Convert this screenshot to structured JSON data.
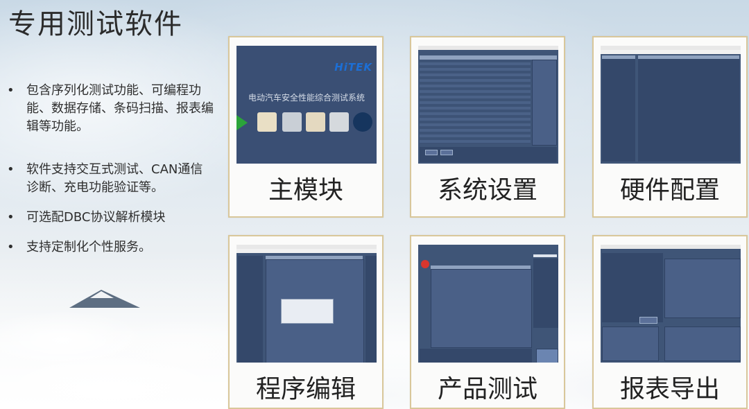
{
  "page": {
    "title": "专用测试软件"
  },
  "bullets": [
    {
      "text": "包含序列化测试功能、可编程功能、数据存储、条码扫描、报表编辑等功能。"
    },
    {
      "text": "软件支持交互式测试、CAN通信诊断、充电功能验证等。"
    },
    {
      "text": "可选配DBC协议解析模块"
    },
    {
      "text": "支持定制化个性服务。"
    }
  ],
  "bullet_symbol": "•",
  "cards": [
    {
      "label": "主模块"
    },
    {
      "label": "系统设置"
    },
    {
      "label": "硬件配置"
    },
    {
      "label": "程序编辑"
    },
    {
      "label": "产品测试"
    },
    {
      "label": "报表导出"
    }
  ],
  "main_module": {
    "brand": "HiTEK",
    "splash_title": "电动汽车安全性能综合测试系统"
  },
  "colors": {
    "card_border": "#d9c79a",
    "screen_bg": "#3f5577",
    "brand_blue": "#1c6fd6"
  }
}
